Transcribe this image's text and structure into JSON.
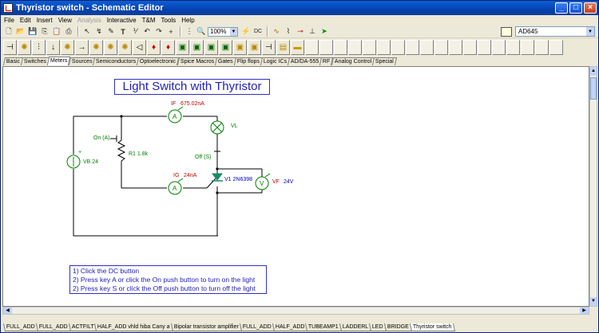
{
  "window": {
    "title": "Thyristor switch - Schematic Editor"
  },
  "menu": [
    "File",
    "Edit",
    "Insert",
    "View",
    "Analysis",
    "Interactive",
    "T&M",
    "Tools",
    "Help"
  ],
  "menu_disabled": [
    "Analysis"
  ],
  "toolbar": {
    "zoom": "100%",
    "part_selector": "AD645"
  },
  "component_tabs": [
    "Basic",
    "Switches",
    "Meters",
    "Sources",
    "Semiconductors",
    "Optoelectronic",
    "Spice Macros",
    "Gates",
    "Flip flops",
    "Logic ICs",
    "AD/DA-555",
    "RF",
    "Analog Control",
    "Special"
  ],
  "active_component_tab": "Meters",
  "diagram": {
    "title": "Light Switch with Thyristor",
    "labels": {
      "if_name": "IF",
      "if_value": "675.02nA",
      "vl": "VL",
      "on_switch": "On (A)",
      "off_switch": "Off (S)",
      "r1": "R1 1.8k",
      "vb": "VB 24",
      "ig_name": "IG",
      "ig_value": "24nA",
      "v1": "V1 2N6398",
      "vf_name": "VF",
      "vf_value": "24V"
    },
    "meter_symbols": {
      "ammeter": "A",
      "voltmeter": "V"
    },
    "instructions": [
      "1) Click the DC button",
      "2) Press key A or click the On push button to turn on the light",
      "2) Press key S or click the Off push button to turn off the light"
    ]
  },
  "sheet_tabs": [
    "FULL_ADD",
    "FULL_ADD",
    "ACTFILT",
    "HALF_ADD vhld hiba Cany a",
    "Bipolar transistor amplifier",
    "FULL_ADD",
    "HALF_ADD",
    "TUBEAMP1",
    "LADDERL",
    "LED",
    "BRIDGE",
    "Thyristor switch"
  ],
  "active_sheet_tab": "Thyristor switch"
}
